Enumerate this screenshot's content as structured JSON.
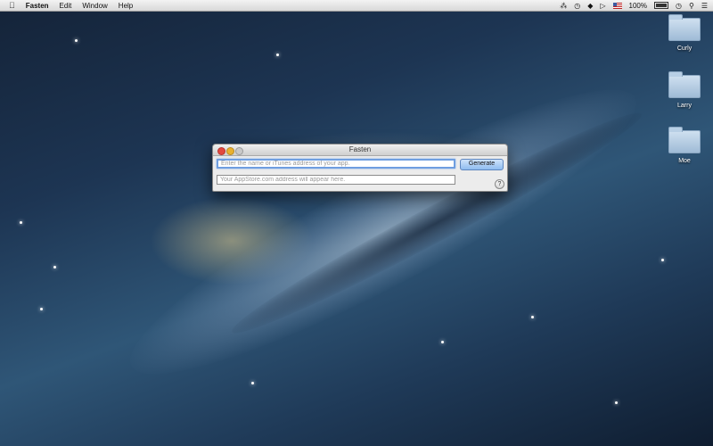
{
  "menubar": {
    "apple_icon": "apple-icon",
    "app_name": "Fasten",
    "menus": [
      "Edit",
      "Window",
      "Help"
    ],
    "status": {
      "battery_percent": "100%",
      "icons": [
        "bluetooth-icon",
        "time-machine-icon",
        "wifi-icon",
        "volume-icon",
        "flag-icon",
        "battery-icon",
        "clock-icon",
        "search-icon",
        "list-icon"
      ]
    }
  },
  "desktop": {
    "folders": [
      {
        "name": "Curly"
      },
      {
        "name": "Larry"
      },
      {
        "name": "Moe"
      }
    ]
  },
  "window": {
    "title": "Fasten",
    "input_placeholder": "Enter the name or iTunes address of your app.",
    "generate_label": "Generate",
    "output_placeholder": "Your AppStore.com address will appear here.",
    "help_label": "?"
  },
  "colors": {
    "close": "#e2493f",
    "minimize": "#e9b12f",
    "zoom": "#c9c9c9",
    "button_accent": "#8fbcf0"
  }
}
